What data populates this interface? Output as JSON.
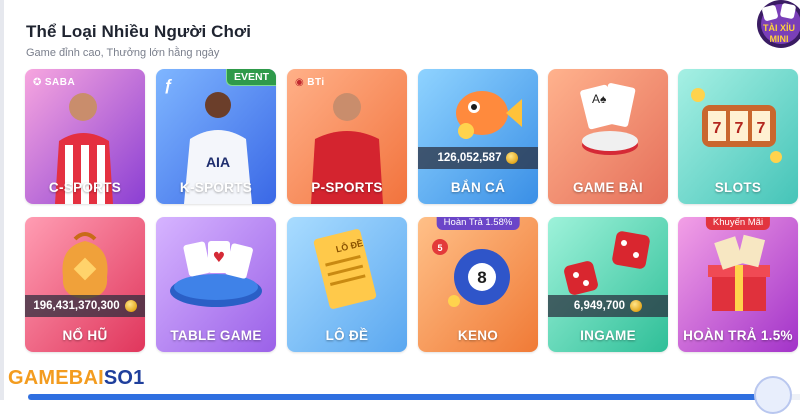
{
  "section": {
    "title": "Thể Loại Nhiều Người Chơi",
    "subtitle": "Game đỉnh cao, Thưởng lớn hằng ngày"
  },
  "tiles": [
    {
      "label": "C-SPORTS",
      "provider": "SABA",
      "colors": [
        "#f7a6df",
        "#8b3fd3"
      ]
    },
    {
      "label": "K-SPORTS",
      "badge": "EVENT",
      "colors": [
        "#7fb6ff",
        "#3a68e6"
      ]
    },
    {
      "label": "P-SPORTS",
      "provider": "BTi",
      "colors": [
        "#ffb088",
        "#f2733d"
      ]
    },
    {
      "label": "BẮN CÁ",
      "jackpot": "126,052,587",
      "colors": [
        "#8fd3ff",
        "#3a8fe6"
      ]
    },
    {
      "label": "GAME BÀI",
      "colors": [
        "#ffb28d",
        "#e56f5a"
      ]
    },
    {
      "label": "SLOTS",
      "colors": [
        "#a6f0e4",
        "#45c4b8"
      ]
    },
    {
      "label": "NỔ HŨ",
      "jackpot": "196,431,370,300",
      "colors": [
        "#ff9db3",
        "#e0365c"
      ]
    },
    {
      "label": "TABLE GAME",
      "colors": [
        "#d6b4ff",
        "#9b61e8"
      ]
    },
    {
      "label": "LÔ ĐỀ",
      "colors": [
        "#a9dcff",
        "#5aa7f0"
      ]
    },
    {
      "label": "KENO",
      "badge_center": "Hoàn Trả 1.58%",
      "colors": [
        "#ffc088",
        "#f07a36"
      ]
    },
    {
      "label": "INGAME",
      "jackpot": "6,949,700",
      "colors": [
        "#9ef2da",
        "#2fbf98"
      ]
    },
    {
      "label": "HOÀN TRẢ 1.5%",
      "badge_center": "Khuyến Mãi",
      "colors": [
        "#f3a0e6",
        "#a233c9"
      ]
    }
  ],
  "footer": {
    "logo_part1": "GAMEBAI",
    "logo_part2": "SO1"
  },
  "corner_badge": {
    "text_top": "TÀI XỈU",
    "text_bottom": "MINI"
  }
}
